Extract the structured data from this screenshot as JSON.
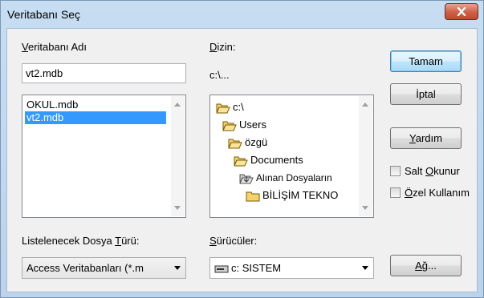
{
  "window": {
    "title": "Veritabanı Seç",
    "close_icon": "close-icon"
  },
  "db_name": {
    "label_underlined": "V",
    "label_rest": "eritabanı Adı",
    "value": "vt2.mdb",
    "files": [
      {
        "name": "OKUL.mdb",
        "selected": false
      },
      {
        "name": "vt2.mdb",
        "selected": true
      }
    ]
  },
  "directory": {
    "label_underlined": "D",
    "label_rest": "izin:",
    "current_path": "c:\\...",
    "tree": [
      {
        "name": "c:\\",
        "icon": "folder-open-icon"
      },
      {
        "name": "Users",
        "icon": "folder-open-icon"
      },
      {
        "name": "özgü",
        "icon": "folder-open-icon"
      },
      {
        "name": "Documents",
        "icon": "folder-open-icon"
      },
      {
        "name": "Alınan Dosyaların",
        "icon": "folder-download-icon"
      },
      {
        "name": "BİLİŞİM TEKNO",
        "icon": "folder-closed-icon"
      }
    ]
  },
  "buttons": {
    "ok": "Tamam",
    "cancel": "İptal",
    "help_underlined": "Y",
    "help_rest": "ardım",
    "network_underlined": "A",
    "network_rest": "ğ..."
  },
  "options": {
    "readonly_pre": "Salt ",
    "readonly_underlined": "O",
    "readonly_post": "kunur",
    "readonly_checked": false,
    "exclusive_underlined": "Ö",
    "exclusive_rest": "zel Kullanım",
    "exclusive_checked": false
  },
  "file_type": {
    "label_pre": "Listelenecek Dosya ",
    "label_underlined": "T",
    "label_post": "ürü:",
    "value": "Access Veritabanları (*.m"
  },
  "drives": {
    "label_underlined": "S",
    "label_rest": "ürücüler:",
    "value": "c: SISTEM",
    "icon": "drive-icon"
  }
}
